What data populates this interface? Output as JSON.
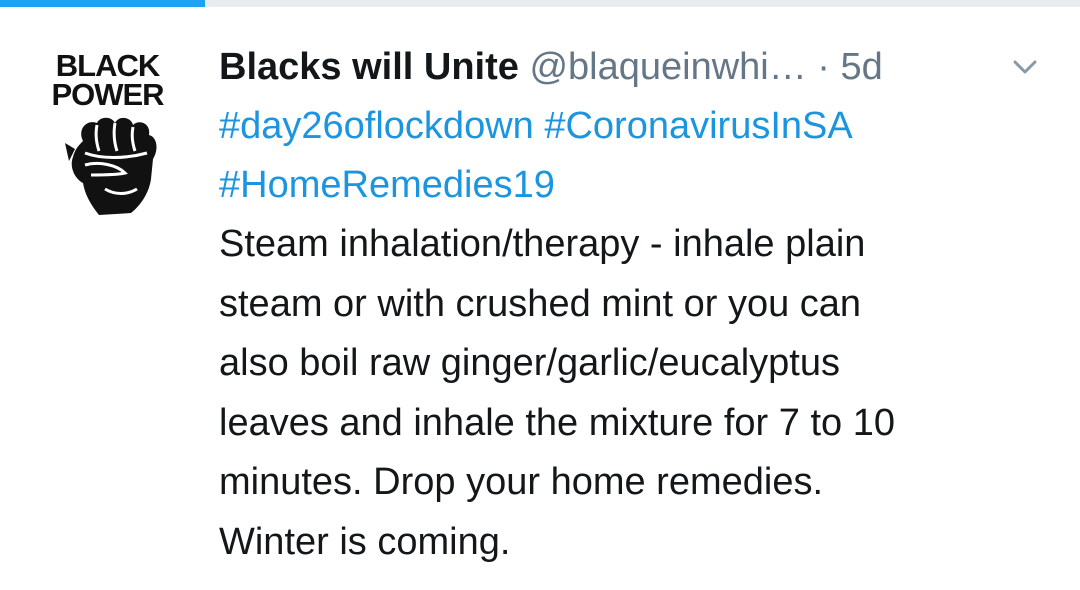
{
  "avatar": {
    "line1": "BLACK",
    "line2": "POWER",
    "icon": "raised-fist-icon"
  },
  "tweet": {
    "author_name": "Blacks will Unite",
    "handle": "@blaqueinwhi…",
    "separator": "·",
    "time": "5d",
    "hashtags_line1": "#day26oflockdown #CoronavirusInSA",
    "hashtags_line2": "#HomeRemedies19",
    "body_lines": [
      "Steam inhalation/therapy - inhale plain",
      "steam or with crushed mint or you can",
      "also boil raw ginger/garlic/eucalyptus",
      "leaves and inhale the mixture for 7 to 10",
      "minutes. Drop your home remedies.",
      "Winter is coming."
    ]
  },
  "colors": {
    "link": "#1b95e0",
    "text": "#14171a",
    "muted": "#657786",
    "progress": "#1da1f2"
  }
}
